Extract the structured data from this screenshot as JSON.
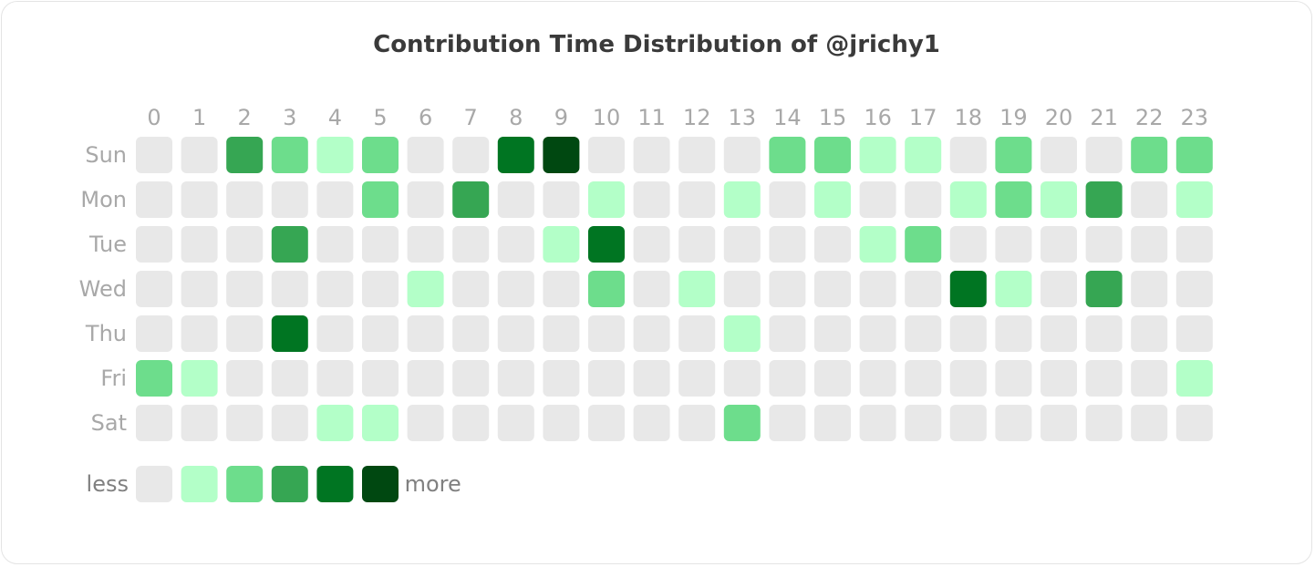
{
  "chart_data": {
    "type": "heatmap",
    "title": "Contribution Time Distribution of @jrichy1",
    "xlabel": "",
    "ylabel": "",
    "x_categories": [
      "0",
      "1",
      "2",
      "3",
      "4",
      "5",
      "6",
      "7",
      "8",
      "9",
      "10",
      "11",
      "12",
      "13",
      "14",
      "15",
      "16",
      "17",
      "18",
      "19",
      "20",
      "21",
      "22",
      "23"
    ],
    "y_categories": [
      "Sun",
      "Mon",
      "Tue",
      "Wed",
      "Thu",
      "Fri",
      "Sat"
    ],
    "levels": [
      [
        0,
        0,
        3,
        2,
        1,
        2,
        0,
        0,
        4,
        5,
        0,
        0,
        0,
        0,
        2,
        2,
        1,
        1,
        0,
        2,
        0,
        0,
        2,
        2
      ],
      [
        0,
        0,
        0,
        0,
        0,
        2,
        0,
        3,
        0,
        0,
        1,
        0,
        0,
        1,
        0,
        1,
        0,
        0,
        1,
        2,
        1,
        3,
        0,
        1
      ],
      [
        0,
        0,
        0,
        3,
        0,
        0,
        0,
        0,
        0,
        1,
        4,
        0,
        0,
        0,
        0,
        0,
        1,
        2,
        0,
        0,
        0,
        0,
        0,
        0
      ],
      [
        0,
        0,
        0,
        0,
        0,
        0,
        1,
        0,
        0,
        0,
        2,
        0,
        1,
        0,
        0,
        0,
        0,
        0,
        4,
        1,
        0,
        3,
        0,
        0
      ],
      [
        0,
        0,
        0,
        4,
        0,
        0,
        0,
        0,
        0,
        0,
        0,
        0,
        0,
        1,
        0,
        0,
        0,
        0,
        0,
        0,
        0,
        0,
        0,
        0
      ],
      [
        2,
        1,
        0,
        0,
        0,
        0,
        0,
        0,
        0,
        0,
        0,
        0,
        0,
        0,
        0,
        0,
        0,
        0,
        0,
        0,
        0,
        0,
        0,
        1
      ],
      [
        0,
        0,
        0,
        0,
        1,
        1,
        0,
        0,
        0,
        0,
        0,
        0,
        0,
        2,
        0,
        0,
        0,
        0,
        0,
        0,
        0,
        0,
        0,
        0
      ]
    ],
    "color_scale": [
      "#e8e8e8",
      "#b3ffc8",
      "#6ddd8c",
      "#36a653",
      "#007522",
      "#004811"
    ],
    "legend": {
      "less_label": "less",
      "more_label": "more",
      "placement": "bottom-left"
    }
  }
}
